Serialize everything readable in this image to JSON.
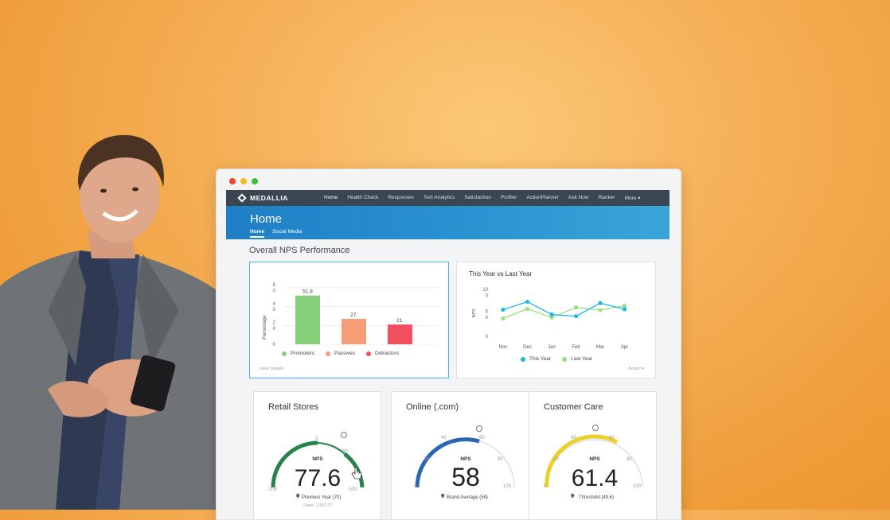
{
  "app": {
    "brand": "MEDALLIA",
    "nav": [
      "Home",
      "Health Check",
      "Responses",
      "Text Analytics",
      "Satisfaction",
      "Profiler",
      "ActionPlanner",
      "Ask Now",
      "Ranker",
      "More ▾"
    ],
    "active_nav": "Home",
    "page_title": "Home",
    "subtabs": [
      "Home",
      "Social Media"
    ],
    "section_title": "Overall NPS Performance"
  },
  "nps_bar": {
    "ylabel": "Percentage",
    "tick_labels": [
      "6\n0",
      "4\n0",
      "2\n0",
      "0"
    ],
    "view_details": "View Details",
    "categories": [
      "Promoters",
      "Passives",
      "Detractors"
    ],
    "values": [
      51.8,
      27,
      21
    ],
    "value_labels": [
      "51.8",
      "27.",
      "21."
    ],
    "colors": [
      "#86d07c",
      "#f79e77",
      "#f44f5f"
    ]
  },
  "trend": {
    "title": "This Year vs Last Year",
    "ylabel": "NPS",
    "y_tick_labels": [
      "10\n0",
      "5\n0",
      "0"
    ],
    "x_labels": [
      "Nov",
      "Dec",
      "Jan",
      "Feb",
      "Mar",
      "Apr"
    ],
    "legend": [
      "This Year",
      "Last Year"
    ],
    "action": "Action ▾"
  },
  "gauges": [
    {
      "title": "Retail Stores",
      "label": "NPS",
      "value": "77.6",
      "ticks": [
        "-100",
        "0",
        "50",
        "100"
      ],
      "reference": "Previous Year (70)",
      "rank": "Rank: 139/173"
    },
    {
      "title": "Online (.com)",
      "label": "NPS",
      "value": "58",
      "ticks": [
        "0",
        "20",
        "40",
        "60",
        "80",
        "100"
      ],
      "reference": "Brand Average (58)"
    },
    {
      "title": "Customer Care",
      "label": "NPS",
      "value": "61.4",
      "ticks": [
        "0",
        "20",
        "40",
        "60",
        "80",
        "100"
      ],
      "reference": "Threshold (49.6)"
    }
  ],
  "chart_data": [
    {
      "type": "bar",
      "categories": [
        "Promoters",
        "Passives",
        "Detractors"
      ],
      "values": [
        51.8,
        27,
        21
      ],
      "ylabel": "Percentage",
      "ylim": [
        0,
        60
      ]
    },
    {
      "type": "line",
      "title": "This Year vs Last Year",
      "ylabel": "NPS",
      "x": [
        "Nov",
        "Dec",
        "Jan",
        "Feb",
        "Mar",
        "Apr"
      ],
      "ylim": [
        0,
        100
      ],
      "series": [
        {
          "name": "This Year",
          "color": "#1fb8e6",
          "values": [
            61,
            79,
            50,
            46,
            76,
            62
          ]
        },
        {
          "name": "Last Year",
          "color": "#9be07b",
          "values": [
            41,
            63,
            43,
            66,
            60,
            70
          ]
        }
      ]
    }
  ],
  "colors": {
    "nav_bg": "#3b4653",
    "hero_blue": "#1f7fc6",
    "retail_gauge": "#27834a",
    "online_gauge": "#2b66b0",
    "care_gauge": "#ecd12b",
    "this_year": "#1fb8e6",
    "last_year": "#9be07b"
  }
}
